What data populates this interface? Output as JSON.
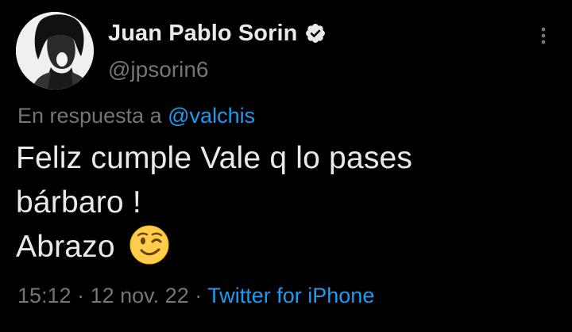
{
  "colors": {
    "background": "#000000",
    "primary_text": "#e7e9ea",
    "secondary_text": "#71767b",
    "link": "#1d9bf0"
  },
  "author": {
    "display_name": "Juan Pablo Sorin",
    "handle": "@jpsorin6",
    "verified": true,
    "verified_icon": "verified-badge-icon",
    "avatar": "black-and-white-portrait"
  },
  "menu": {
    "icon": "more-options-icon"
  },
  "reply": {
    "prefix": "En respuesta a",
    "mention": "@valchis"
  },
  "tweet": {
    "line1": "Feliz cumple Vale q lo pases",
    "line2": "bárbaro !",
    "line3": "Abrazo",
    "emoji": "winking-face-emoji"
  },
  "meta": {
    "time": "15:12",
    "separator1": "·",
    "date": "12 nov. 22",
    "separator2": "·",
    "source": "Twitter for iPhone"
  }
}
